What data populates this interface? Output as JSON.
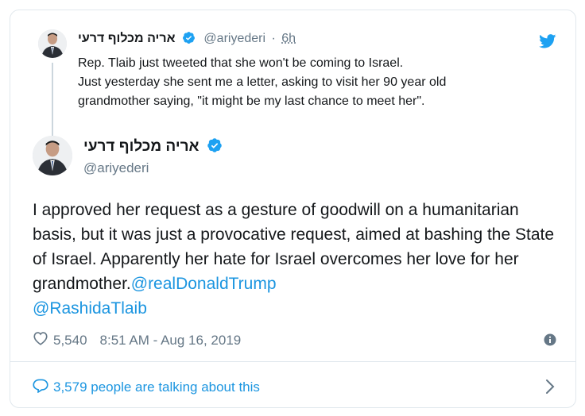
{
  "parent_tweet": {
    "display_name": "אריה מכלוף דרעי",
    "handle": "@ariyederi",
    "separator": "·",
    "time_ago": "6h",
    "text_lines": [
      "Rep. Tlaib just tweeted that she won't be coming to Israel.",
      "Just yesterday she sent me a letter, asking to visit her 90 year old",
      "grandmother saying, \"it might be my last chance to meet her\"."
    ]
  },
  "main_tweet": {
    "display_name": "אריה מכלוף דרעי",
    "handle": "@ariyederi",
    "text": "I approved her request as a gesture of goodwill on a humanitarian basis, but it was just a provocative request, aimed at bashing the State of Israel. Apparently her hate for Israel overcomes her love for her grandmother.",
    "mentions": [
      "@realDonaldTrump",
      "@RashidaTlaib"
    ],
    "likes": "5,540",
    "timestamp": "8:51 AM - Aug 16, 2019"
  },
  "conversation": {
    "label": "3,579 people are talking about this"
  },
  "colors": {
    "link": "#1b95e0",
    "verified": "#1da1f2",
    "muted": "#657786",
    "border": "#e1e8ed"
  },
  "icons": [
    "twitter-bird-icon",
    "verified-badge-icon",
    "heart-icon",
    "info-icon",
    "speech-bubble-icon",
    "chevron-right-icon"
  ]
}
